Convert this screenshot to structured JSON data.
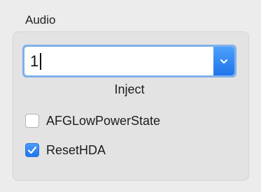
{
  "section": {
    "title": "Audio"
  },
  "inject": {
    "value": "1",
    "label": "Inject"
  },
  "options": [
    {
      "label": "AFGLowPowerState",
      "checked": false
    },
    {
      "label": "ResetHDA",
      "checked": true
    }
  ],
  "colors": {
    "accent": "#2f7cf0",
    "focus_ring": "#7fb0ec",
    "panel": "#e3e3e3",
    "window": "#ececec"
  },
  "icons": {
    "combo_button": "chevron-down-icon",
    "checkmark": "checkmark-icon"
  }
}
